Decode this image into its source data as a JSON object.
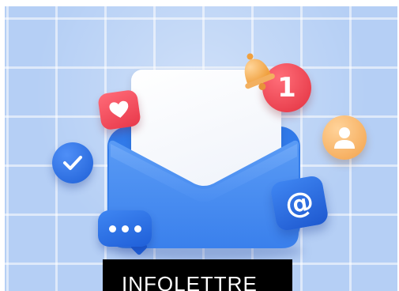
{
  "hero": {
    "icons": [
      "heart-icon",
      "checkmark-icon",
      "chat-dots-icon",
      "at-sign-icon",
      "user-icon",
      "bell-icon",
      "envelope-icon",
      "letter-icon"
    ],
    "notification_count": "1",
    "at_symbol": "@"
  },
  "caption": {
    "text": "INFOLETTRE"
  },
  "colors": {
    "background": "#b5cff5",
    "envelope": "#3d86f0",
    "red_badge": "#e8384a",
    "orange_badge": "#f3a24b",
    "blue_badge": "#1f5fd8",
    "caption_background": "#000000",
    "caption_text": "#ffffff"
  }
}
